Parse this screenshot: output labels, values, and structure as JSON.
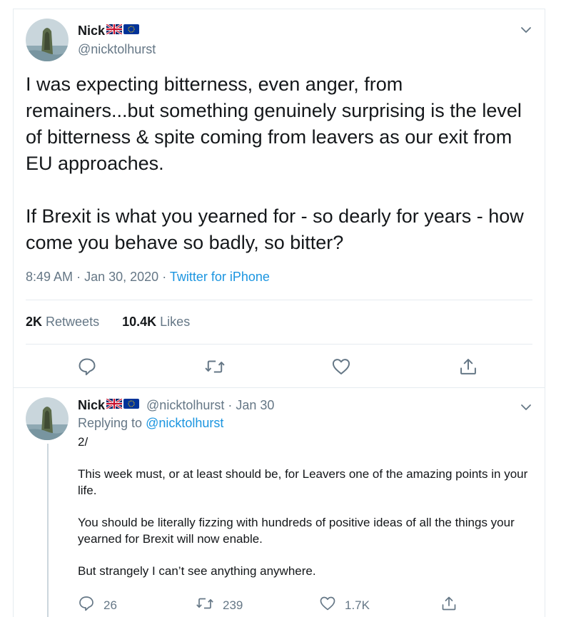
{
  "tweet": {
    "author_name": "Nick",
    "handle": "@nicktolhurst",
    "paragraph1": "I was expecting bitterness, even anger, from remainers...but something genuinely surprising is the level of bitterness & spite coming from leavers as our exit from EU approaches.",
    "paragraph2": "If Brexit is what you yearned for - so dearly for years - how come you behave so badly, so bitter?",
    "time": "8:49 AM",
    "date": "Jan 30, 2020",
    "separator": "·",
    "source": "Twitter for iPhone",
    "retweets_count": "2K",
    "retweets_label": "Retweets",
    "likes_count": "10.4K",
    "likes_label": "Likes",
    "icons": [
      "reply-icon",
      "retweet-icon",
      "like-icon",
      "share-icon"
    ]
  },
  "reply": {
    "author_name": "Nick",
    "handle": "@nicktolhurst",
    "separator": "·",
    "date": "Jan 30",
    "replying_prefix": "Replying to",
    "replying_to": "@nicktolhurst",
    "line1": "2/",
    "paragraph1": "This week must, or at least should be, for Leavers one of the amazing points in your life.",
    "paragraph2": "You should be literally fizzing with hundreds of positive ideas of all the things your yearned for Brexit will now enable.",
    "paragraph3": "But strangely I can’t see anything anywhere.",
    "reply_count": "26",
    "retweet_count": "239",
    "like_count": "1.7K"
  },
  "colors": {
    "text": "#14171a",
    "secondary": "#657786",
    "link": "#1b95e0",
    "border": "#e6ecf0"
  }
}
